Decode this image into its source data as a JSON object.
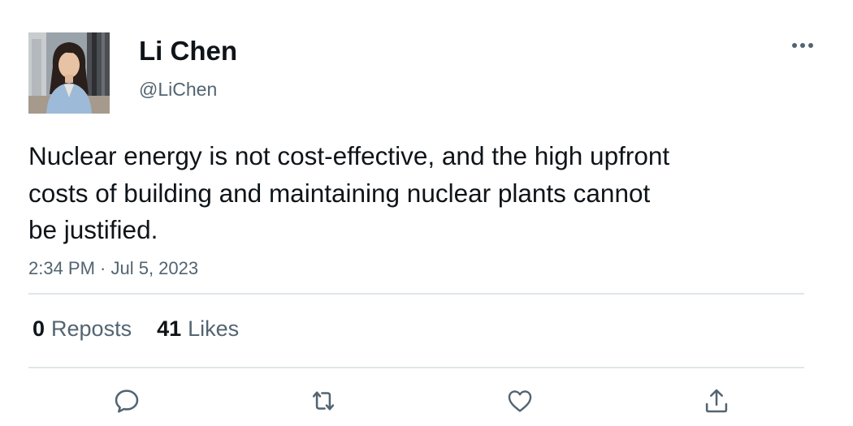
{
  "author": {
    "display_name": "Li Chen",
    "handle": "@LiChen"
  },
  "tweet": {
    "text": "Nuclear energy is not cost-effective, and the high upfront costs of building and maintaining nuclear plants cannot be justified.",
    "timestamp": "2:34 PM · Jul 5, 2023"
  },
  "stats": {
    "reposts_count": "0",
    "reposts_label": "Reposts",
    "likes_count": "41",
    "likes_label": "Likes"
  },
  "icons": {
    "more": "more-horizontal-icon",
    "reply": "reply-icon",
    "repost": "repost-icon",
    "like": "heart-icon",
    "share": "share-icon"
  },
  "colors": {
    "text_primary": "#0f1419",
    "text_secondary": "#536471",
    "divider": "#e1e6ea"
  }
}
